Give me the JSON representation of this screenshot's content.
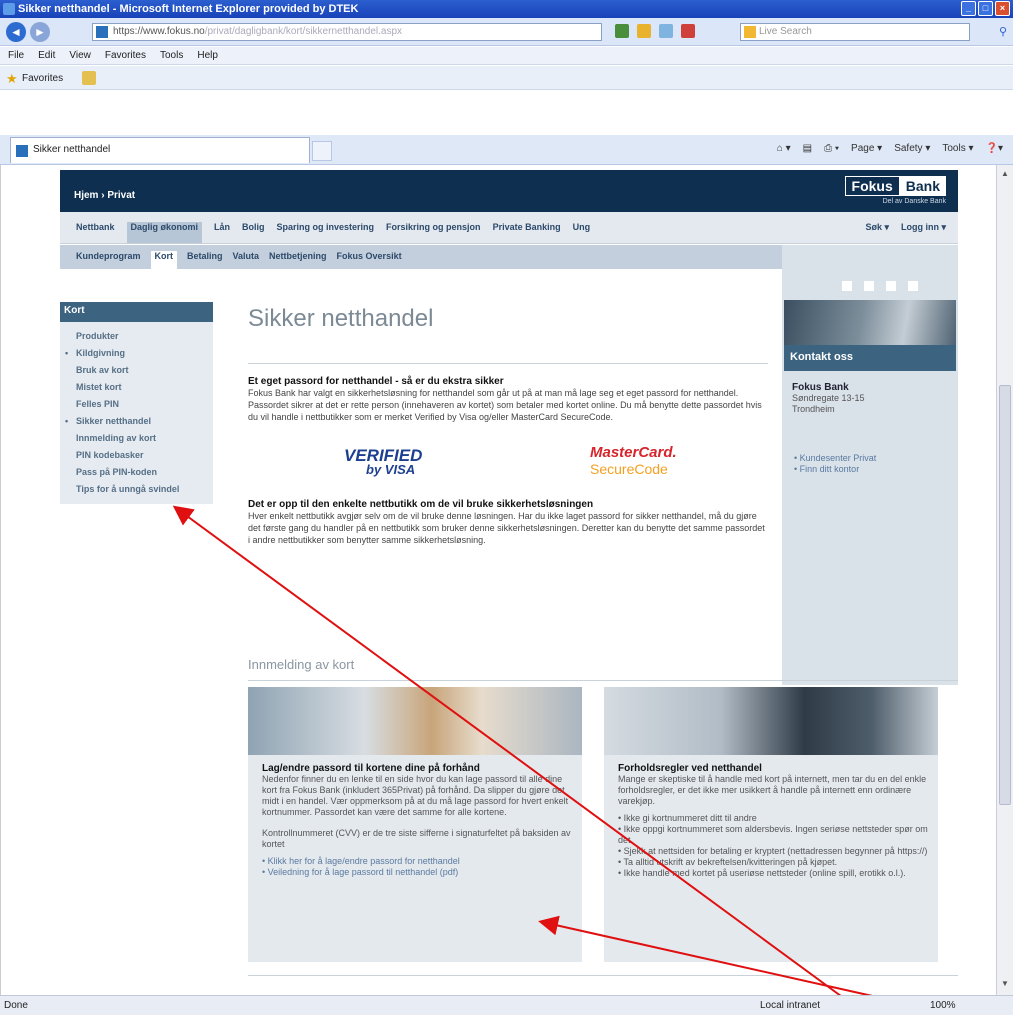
{
  "window": {
    "title": "Sikker netthandel - Microsoft Internet Explorer provided by DTEK"
  },
  "address": {
    "url_host": "https://www.fokus.no",
    "url_path": "/privat/dagligbank/kort/sikkernetthandel.aspx"
  },
  "search": {
    "placeholder": "Live Search"
  },
  "menu": [
    "File",
    "Edit",
    "View",
    "Favorites",
    "Tools",
    "Help"
  ],
  "favorites": {
    "label": "Favorites"
  },
  "tab": {
    "label": "Sikker netthandel"
  },
  "cmd": [
    "Page ▾",
    "Safety ▾",
    "Tools ▾"
  ],
  "site": {
    "breadcrumb": "Hjem › Privat",
    "logo_a": "Fokus",
    "logo_b": "Bank",
    "logo_sub": "Del av Danske Bank",
    "mainnav": [
      "Nettbank",
      "Daglig økonomi",
      "Lån",
      "Bolig",
      "Sparing og investering",
      "Forsikring og pensjon",
      "Private Banking",
      "Ung"
    ],
    "mainnav_right": [
      "Søk ▾",
      "Logg inn ▾"
    ],
    "subnav": [
      "Kundeprogram",
      "Kort",
      "Betaling",
      "Valuta",
      "Nettbetjening",
      "Fokus Oversikt"
    ],
    "leftmenu_head": "Kort",
    "leftmenu": [
      "Produkter",
      "Kildgivning",
      "Bruk av kort",
      "Mistet kort",
      "Felles PIN",
      "Sikker netthandel",
      "Innmelding av kort",
      "PIN kodebasker",
      "Pass på PIN-koden",
      "Tips for å unngå svindel"
    ],
    "page_title": "Sikker netthandel",
    "h_passord": "Et eget passord for netthandel - så er du ekstra sikker",
    "p_passord": "Fokus Bank har valgt en sikkerhetsløsning for netthandel som går ut på at man må lage seg et eget passord for netthandel. Passordet sikrer at det er rette person (innehaveren av kortet) som betaler med kortet online. Du må benytte dette passordet hvis du vil handle i nettbutikker som er merket Verified by Visa og/eller MasterCard SecureCode.",
    "verified": "VERIFIED",
    "byvisa": "by VISA",
    "mastercard": "MasterCard.",
    "securecode": "SecureCode",
    "h_opp": "Det er opp til den enkelte nettbutikk om de vil bruke sikkerhetsløsningen",
    "p_opp": "Hver enkelt nettbutikk avgjør selv om de vil bruke denne løsningen. Har du ikke laget passord for sikker netthandel, må du gjøre det første gang du handler på en nettbutikk som bruker denne sikkerhetsløsningen. Deretter kan du benytte det samme passordet i andre nettbutikker som benytter samme sikkerhetsløsning.",
    "section2_title": "Innmelding av kort",
    "box1_title": "Lag/endre passord til kortene dine på forhånd",
    "box1_text": "Nedenfor finner du en lenke til en side hvor du kan lage passord til alle dine kort fra Fokus Bank (inkludert 365Privat) på forhånd. Da slipper du gjøre det midt i en handel. Vær oppmerksom på at du må lage passord for hvert enkelt kortnummer. Passordet kan være det samme for alle kortene.",
    "box1_text2": "Kontrollnummeret (CVV) er de tre siste sifferne i signaturfeltet på baksiden av kortet",
    "box1_links": [
      "Klikk her for å lage/endre passord for netthandel",
      "Veiledning for å lage passord til netthandel (pdf)"
    ],
    "box2_title": "Forholdsregler ved netthandel",
    "box2_text": "Mange er skeptiske til å handle med kort på internett, men tar du en del enkle forholdsregler, er det ikke mer usikkert å handle på internett enn ordinære varekjøp.",
    "box2_list": [
      "Ikke gi kortnummeret ditt til andre",
      "Ikke oppgi kortnummeret som aldersbevis. Ingen seriøse nettsteder spør om det.",
      "Sjekk at nettsiden for betaling er kryptert (nettadressen begynner på https://)",
      "Ta alltid utskrift av bekreftelsen/kvitteringen på kjøpet.",
      "Ikke handle med kortet på useriøse nettsteder (online spill, erotikk o.l.)."
    ],
    "contact_head": "Kontakt oss",
    "contact_name": "Fokus Bank",
    "contact_addr1": "Søndregate 13-15",
    "contact_addr2": "Trondheim",
    "contact_links": [
      "Kundesenter Privat",
      "Finn ditt kontor"
    ]
  },
  "status": {
    "left": "Done",
    "zone": "Local intranet",
    "zoom": "100%"
  }
}
